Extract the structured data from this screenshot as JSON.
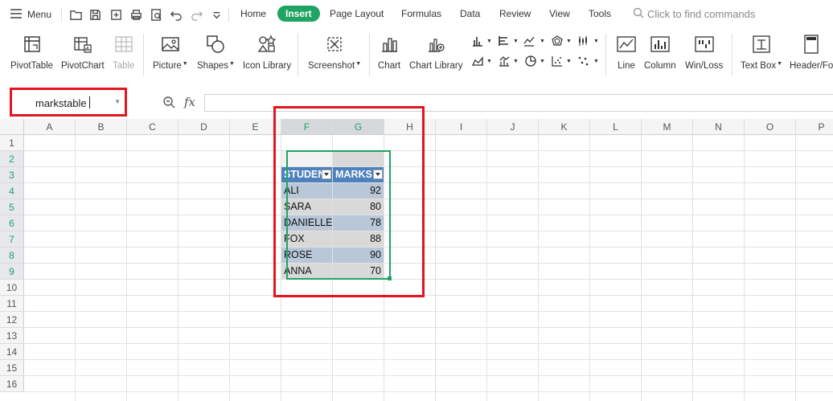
{
  "menu": {
    "label": "Menu"
  },
  "tabs": [
    {
      "label": "Home"
    },
    {
      "label": "Insert"
    },
    {
      "label": "Page Layout"
    },
    {
      "label": "Formulas"
    },
    {
      "label": "Data"
    },
    {
      "label": "Review"
    },
    {
      "label": "View"
    },
    {
      "label": "Tools"
    }
  ],
  "search": {
    "placeholder": "Click to find commands"
  },
  "ribbon": {
    "pivottable": "PivotTable",
    "pivotchart": "PivotChart",
    "table": "Table",
    "picture": "Picture",
    "shapes": "Shapes",
    "icon_library": "Icon Library",
    "screenshot": "Screenshot",
    "chart": "Chart",
    "chart_library": "Chart Library",
    "line": "Line",
    "column": "Column",
    "winloss": "Win/Loss",
    "textbox": "Text Box",
    "headerfooter": "Header/Fo"
  },
  "namebox": {
    "value": "markstable"
  },
  "formula": {
    "fx": "fx",
    "value": ""
  },
  "columns": [
    "A",
    "B",
    "C",
    "D",
    "E",
    "F",
    "G",
    "H",
    "I",
    "J",
    "K",
    "L",
    "M",
    "N",
    "O",
    "P"
  ],
  "rows": [
    "1",
    "2",
    "3",
    "4",
    "5",
    "6",
    "7",
    "8",
    "9",
    "10",
    "11",
    "12",
    "13",
    "14",
    "15",
    "16"
  ],
  "table": {
    "headers": [
      "STUDENT",
      "MARKS"
    ],
    "rows": [
      {
        "name": "ALI",
        "marks": "92"
      },
      {
        "name": "SARA",
        "marks": "80"
      },
      {
        "name": "DANIELLE",
        "marks": "78"
      },
      {
        "name": "FOX",
        "marks": "88"
      },
      {
        "name": "ROSE",
        "marks": "90"
      },
      {
        "name": "ANNA",
        "marks": "70"
      }
    ]
  },
  "colors": {
    "accent": "#1fa463",
    "highlight": "#e3151f",
    "table_header": "#4f81bd"
  }
}
